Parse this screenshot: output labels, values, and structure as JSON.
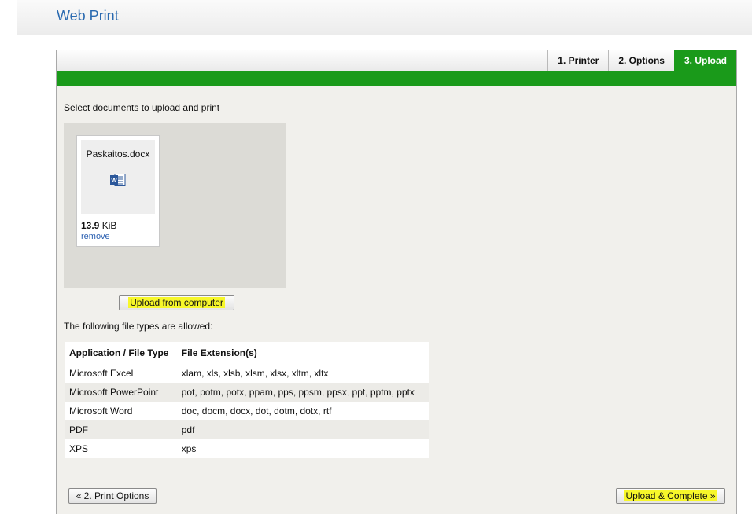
{
  "header": {
    "title": "Web Print"
  },
  "steps": [
    {
      "label": "1. Printer",
      "active": false
    },
    {
      "label": "2. Options",
      "active": false
    },
    {
      "label": "3. Upload",
      "active": true
    }
  ],
  "colors": {
    "accent": "#1a9a1a",
    "link": "#2a5fb0",
    "highlight": "#f7f72a",
    "title": "#2a6ab0"
  },
  "upload": {
    "instruction": "Select documents to upload and print",
    "file": {
      "name": "Paskaitos.docx",
      "icon": "word-document-icon",
      "size_value": "13.9",
      "size_unit": " KiB",
      "remove_label": "remove"
    },
    "upload_button": "Upload from computer"
  },
  "file_types": {
    "intro": "The following file types are allowed:",
    "headers": [
      "Application / File Type",
      "File Extension(s)"
    ],
    "rows": [
      [
        "Microsoft Excel",
        "xlam, xls, xlsb, xlsm, xlsx, xltm, xltx"
      ],
      [
        "Microsoft PowerPoint",
        "pot, potm, potx, ppam, pps, ppsm, ppsx, ppt, pptm, pptx"
      ],
      [
        "Microsoft Word",
        "doc, docm, docx, dot, dotm, dotx, rtf"
      ],
      [
        "PDF",
        "pdf"
      ],
      [
        "XPS",
        "xps"
      ]
    ]
  },
  "footer": {
    "back_button": "« 2. Print Options",
    "complete_button": "Upload & Complete »"
  }
}
